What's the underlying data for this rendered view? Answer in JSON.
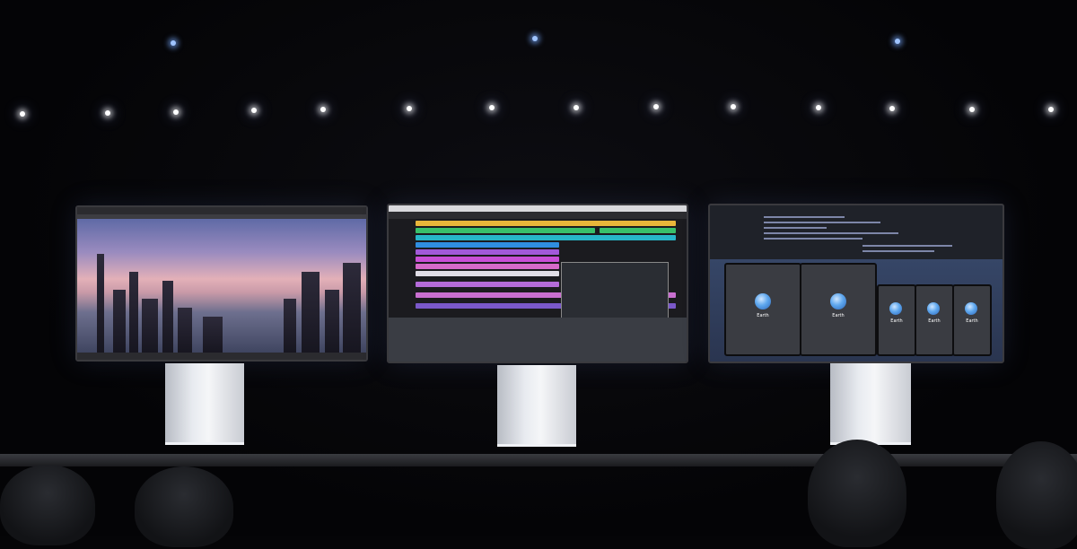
{
  "scene": {
    "background_color": "#050507",
    "monitor_count": 3,
    "monitor_screens": [
      "city-scene-editor",
      "music-daw",
      "code-editor-with-simulators"
    ],
    "device_simulator_count": 5,
    "device_label": "Earth"
  }
}
